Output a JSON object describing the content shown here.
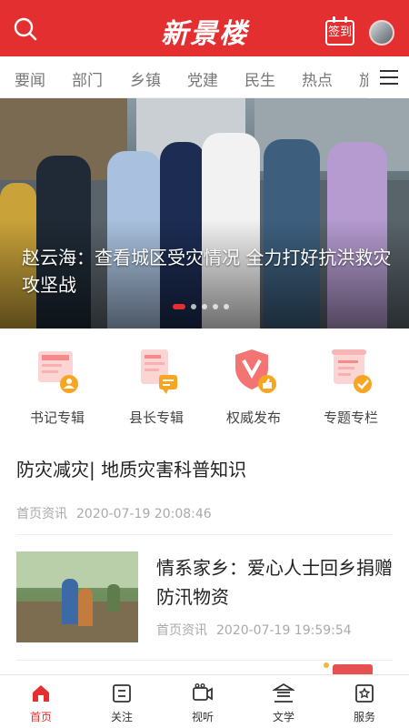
{
  "header": {
    "brand": "新景楼",
    "signin_label": "签到",
    "brand_color": "#e32f2f"
  },
  "tabs": [
    "要闻",
    "部门",
    "乡镇",
    "党建",
    "民生",
    "热点",
    "旅"
  ],
  "banner": {
    "title": "赵云海：查看城区受灾情况 全力打好抗洪救灾攻坚战",
    "slide_count": 5,
    "active_slide": 1
  },
  "quick_entries": [
    {
      "label": "书记专辑",
      "icon": "secretary-album-icon"
    },
    {
      "label": "县长专辑",
      "icon": "county-head-album-icon"
    },
    {
      "label": "权威发布",
      "icon": "authoritative-release-icon"
    },
    {
      "label": "专题专栏",
      "icon": "special-column-icon"
    }
  ],
  "news": [
    {
      "title": "防灾减灾| 地质灾害科普知识",
      "source": "首页资讯",
      "time": "2020-07-19 20:08:46"
    },
    {
      "title": "情系家乡：爱心人士回乡捐赠防汛物资",
      "source": "首页资讯",
      "time": "2020-07-19 19:59:54"
    }
  ],
  "bottom_nav": [
    {
      "label": "首页",
      "icon": "home-icon",
      "active": true
    },
    {
      "label": "关注",
      "icon": "follow-icon",
      "active": false
    },
    {
      "label": "视听",
      "icon": "video-icon",
      "active": false
    },
    {
      "label": "文学",
      "icon": "literature-icon",
      "active": false
    },
    {
      "label": "服务",
      "icon": "service-icon",
      "active": false
    }
  ]
}
